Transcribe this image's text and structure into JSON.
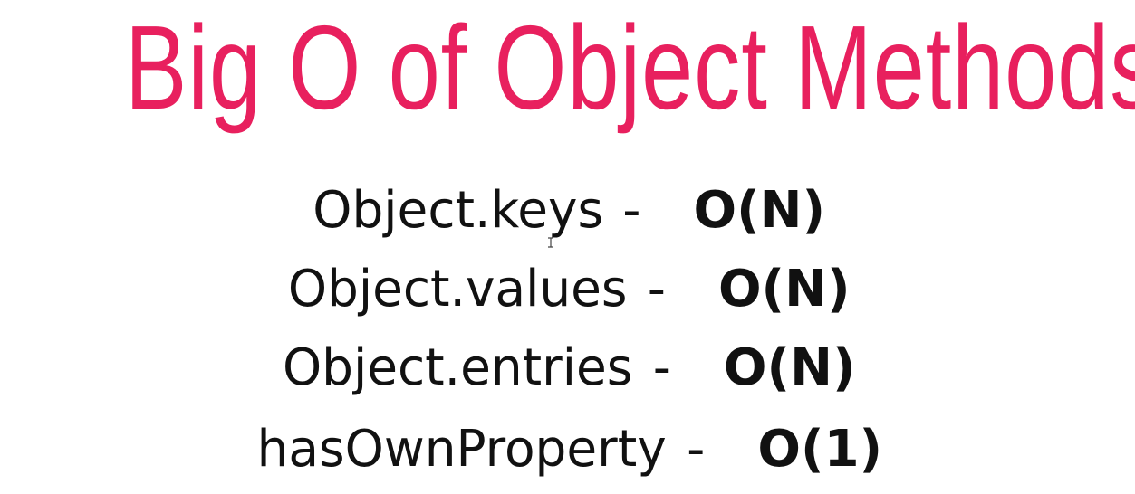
{
  "slide": {
    "title": "Big O of Object Methods",
    "accent_color": "#e8205e",
    "rows": [
      {
        "method": "Object.keys",
        "separator": "-",
        "complexity": "O(N)"
      },
      {
        "method": "Object.values",
        "separator": "-",
        "complexity": "O(N)"
      },
      {
        "method": "Object.entries",
        "separator": "-",
        "complexity": "O(N)"
      },
      {
        "method": "hasOwnProperty",
        "separator": "-",
        "complexity": "O(1)"
      }
    ]
  },
  "cursor": {
    "icon": "text-cursor-icon"
  }
}
